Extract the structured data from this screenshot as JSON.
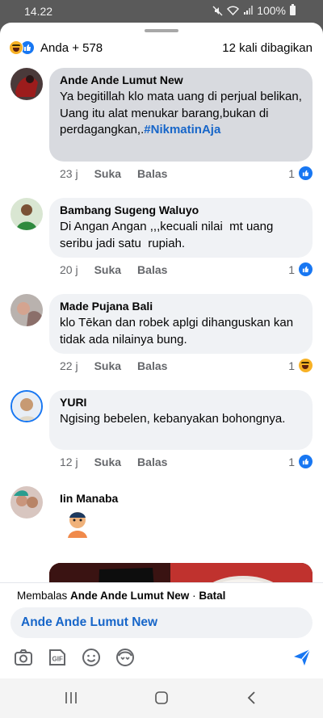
{
  "status": {
    "time": "14.22",
    "battery": "100%"
  },
  "reactions": {
    "summary": "Anda + 578",
    "shares": "12 kali dibagikan"
  },
  "comments": [
    {
      "author": "Ande Ande Lumut New",
      "text": "Ya begitillah klo mata uang di perjual belikan, Uang itu alat menukar barang,bukan di perdagangkan,.",
      "hashtag": "#NikmatinAja",
      "time": "23 j",
      "like": "Suka",
      "reply": "Balas",
      "reaction_count": "1",
      "reaction": "like-icon"
    },
    {
      "author": "Bambang Sugeng Waluyo",
      "text": "Di Angan Angan ,,,kecuali nilai  mt uang seribu jadi satu  rupiah.",
      "time": "20 j",
      "like": "Suka",
      "reply": "Balas",
      "reaction_count": "1",
      "reaction": "like-icon"
    },
    {
      "author": "Made Pujana Bali",
      "text": "klo Tēkan dan robek aplgi dihanguskan kan tidak ada nilainya bung.",
      "time": "22 j",
      "like": "Suka",
      "reply": "Balas",
      "reaction_count": "1",
      "reaction": "haha-icon"
    },
    {
      "author": "YURI",
      "text": "Ngising bebelen, kebanyakan bohongnya.",
      "time": "12 j",
      "like": "Suka",
      "reply": "Balas",
      "reaction_count": "1",
      "reaction": "like-icon"
    },
    {
      "author": "Iin Manaba"
    }
  ],
  "reply_box": {
    "prefix": "Membalas",
    "target": "Ande Ande Lumut New",
    "separator": "·",
    "cancel": "Batal",
    "input_value": "Ande Ande Lumut New"
  },
  "colors": {
    "accent": "#1877f2",
    "link": "#1766c9",
    "bubble": "#f0f2f5"
  }
}
